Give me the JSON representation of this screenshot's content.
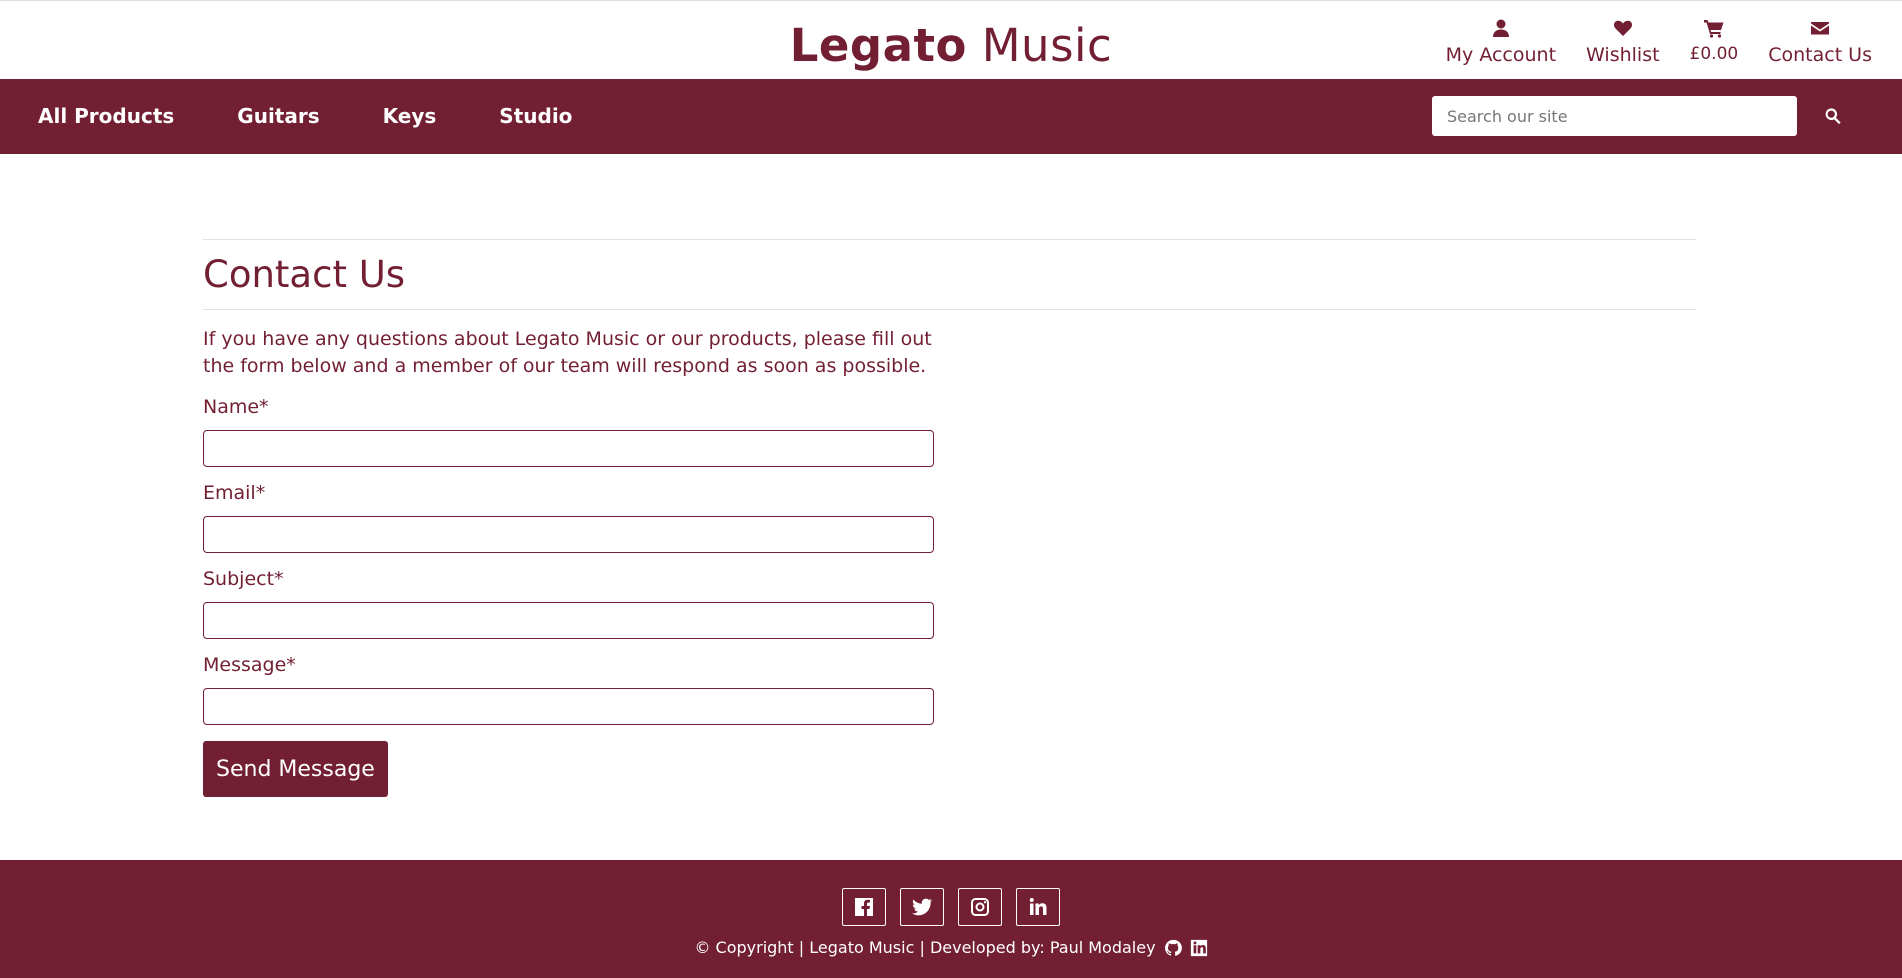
{
  "brand": {
    "bold": "Legato",
    "light": " Music"
  },
  "account_nav": {
    "my_account": "My Account",
    "wishlist": "Wishlist",
    "basket_total": "£0.00",
    "contact_us": "Contact Us"
  },
  "nav": {
    "items": [
      "All Products",
      "Guitars",
      "Keys",
      "Studio"
    ],
    "search_placeholder": "Search our site"
  },
  "page": {
    "title": "Contact Us",
    "intro": "If you have any questions about Legato Music or our products, please fill out the form below and a member of our team will respond as soon as possible.",
    "fields": {
      "name_label": "Name*",
      "email_label": "Email*",
      "subject_label": "Subject*",
      "message_label": "Message*"
    },
    "submit_label": "Send Message"
  },
  "footer": {
    "copyright": "© Copyright | Legato Music | Developed by: Paul Modaley",
    "socials": [
      "facebook-icon",
      "twitter-icon",
      "instagram-icon",
      "linkedin-icon"
    ]
  },
  "colors": {
    "brand": "#721f33",
    "background": "#ffffff"
  }
}
